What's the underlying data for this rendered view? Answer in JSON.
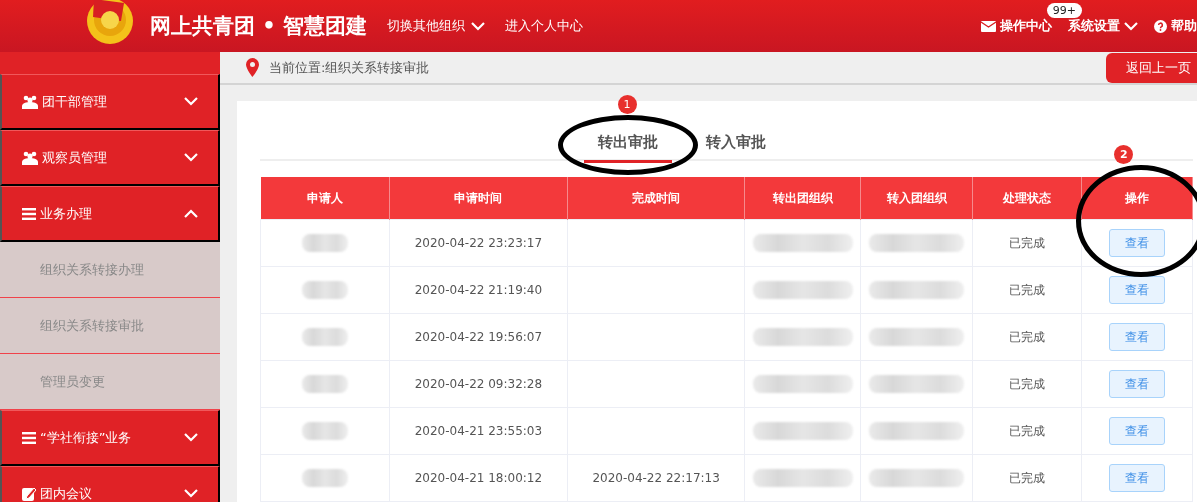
{
  "header": {
    "title": "网上共青团 • 智慧团建",
    "nav": [
      {
        "label": "切换其他组织",
        "dropdown": true
      },
      {
        "label": "进入个人中心",
        "dropdown": false
      }
    ],
    "actions": [
      {
        "kind": "mail",
        "label": "操作中心",
        "badge": "99+"
      },
      {
        "kind": "settings",
        "label": "系统设置"
      },
      {
        "kind": "help",
        "label": "帮助"
      }
    ]
  },
  "sidebar": {
    "items": [
      {
        "label": "团干部管理",
        "kind": "group",
        "expanded": false
      },
      {
        "label": "观察员管理",
        "kind": "group",
        "expanded": false
      },
      {
        "label": "业务办理",
        "kind": "list",
        "expanded": true,
        "children": [
          {
            "label": "组织关系转接办理"
          },
          {
            "label": "组织关系转接审批"
          },
          {
            "label": "管理员变更"
          }
        ]
      },
      {
        "label": "“学社衔接”业务",
        "kind": "list",
        "expanded": false
      },
      {
        "label": "团内会议",
        "kind": "edit",
        "expanded": false
      }
    ]
  },
  "breadcrumb": "当前位置:组织关系转接审批",
  "back_button": "返回上一页",
  "tabs": [
    {
      "label": "转出审批",
      "selected": true
    },
    {
      "label": "转入审批",
      "selected": false
    }
  ],
  "table": {
    "columns": [
      "申请人",
      "申请时间",
      "完成时间",
      "转出团组织",
      "转入团组织",
      "处理状态",
      "操作"
    ],
    "rows": [
      {
        "applied": "2020-04-22 23:23:17",
        "status": "已完成",
        "action": "查看"
      },
      {
        "applied": "2020-04-22 21:19:40",
        "status": "已完成",
        "action": "查看"
      },
      {
        "applied": "2020-04-22 19:56:07",
        "status": "已完成",
        "action": "查看"
      },
      {
        "applied": "2020-04-22 09:32:28",
        "status": "已完成",
        "action": "查看"
      },
      {
        "applied": "2020-04-21 23:55:03",
        "status": "已完成",
        "action": "查看"
      },
      {
        "applied": "2020-04-21 18:00:12",
        "completed": "2020-04-22 22:17:13",
        "status": "已完成",
        "action": "查看"
      }
    ]
  },
  "annotations": [
    {
      "number": "1"
    },
    {
      "number": "2"
    }
  ]
}
